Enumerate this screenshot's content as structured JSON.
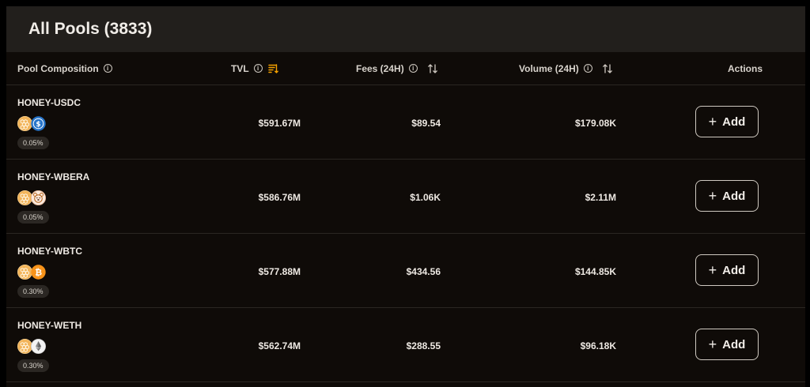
{
  "title": "All Pools (3833)",
  "columns": {
    "pool_composition": "Pool Composition",
    "tvl": "TVL",
    "fees": "Fees (24H)",
    "volume": "Volume (24H)",
    "actions": "Actions"
  },
  "icons": {
    "info": "info-icon",
    "sort_active": "sort-descending-icon",
    "sort": "sort-arrows-icon"
  },
  "colors": {
    "accent": "#f5a100",
    "honey": "#f2b45a",
    "usdc": "#2775ca",
    "btc": "#f7931a",
    "eth": "#f3f3f3",
    "wbera": "#fbe9dc"
  },
  "pools": [
    {
      "name": "HONEY-USDC",
      "fee": "0.05%",
      "tvl": "$591.67M",
      "fees": "$89.54",
      "volume": "$179.08K",
      "action": "Add",
      "token2": "usdc"
    },
    {
      "name": "HONEY-WBERA",
      "fee": "0.05%",
      "tvl": "$586.76M",
      "fees": "$1.06K",
      "volume": "$2.11M",
      "action": "Add",
      "token2": "wbera"
    },
    {
      "name": "HONEY-WBTC",
      "fee": "0.30%",
      "tvl": "$577.88M",
      "fees": "$434.56",
      "volume": "$144.85K",
      "action": "Add",
      "token2": "btc"
    },
    {
      "name": "HONEY-WETH",
      "fee": "0.30%",
      "tvl": "$562.74M",
      "fees": "$288.55",
      "volume": "$96.18K",
      "action": "Add",
      "token2": "eth"
    }
  ]
}
